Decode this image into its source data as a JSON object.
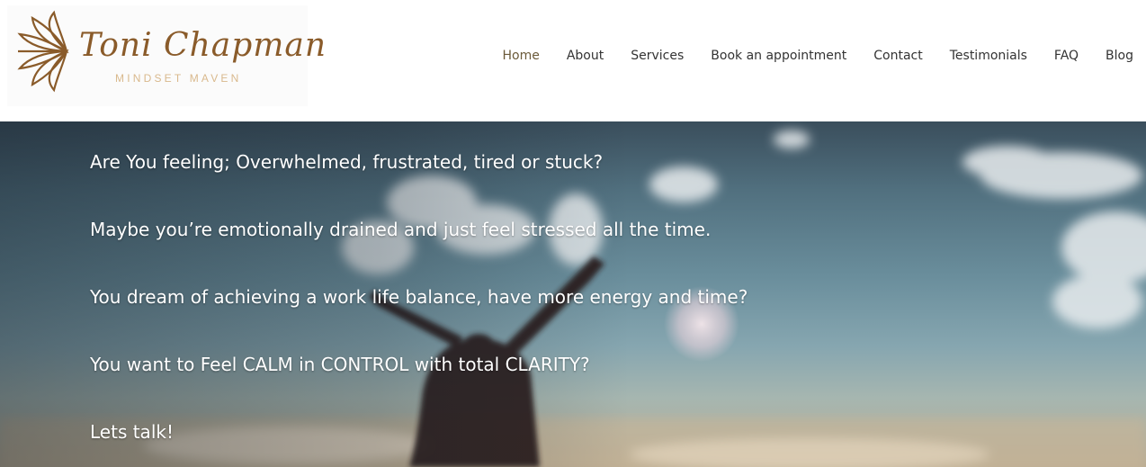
{
  "logo": {
    "name": "Toni Chapman",
    "tagline": "MINDSET MAVEN"
  },
  "nav": {
    "items": [
      {
        "label": "Home"
      },
      {
        "label": "About"
      },
      {
        "label": "Services"
      },
      {
        "label": "Book an appointment"
      },
      {
        "label": "Contact"
      },
      {
        "label": "Testimonials"
      },
      {
        "label": "FAQ"
      },
      {
        "label": "Blog"
      }
    ]
  },
  "hero": {
    "lines": [
      "Are You feeling; Overwhelmed, frustrated, tired or stuck?",
      "Maybe you’re emotionally drained and just feel stressed all the time.",
      "You dream of achieving a work life balance, have more energy and time?",
      "You want to Feel CALM in CONTROL with total CLARITY?",
      "Lets talk!"
    ]
  },
  "colors": {
    "brand": "#8a5b2a",
    "tagline": "#d9b98d",
    "nav_text": "#333333",
    "hero_text": "#ffffff"
  }
}
